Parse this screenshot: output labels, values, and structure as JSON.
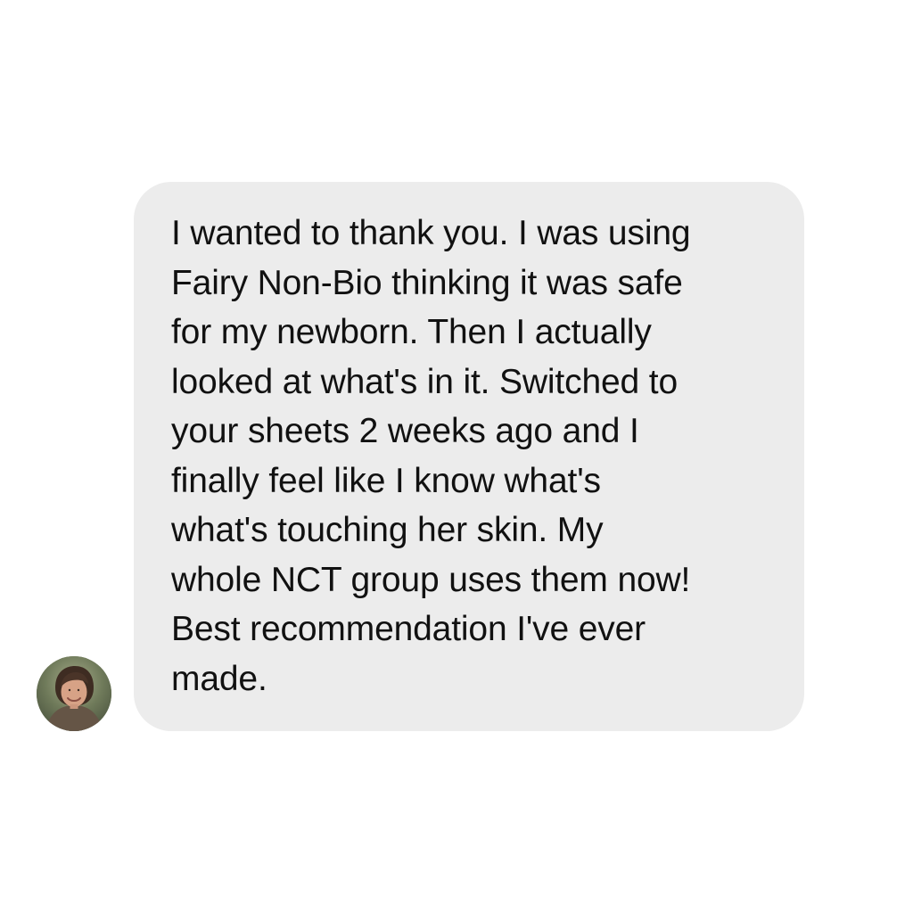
{
  "conversation": {
    "message": {
      "text": "I wanted to thank you. I was using\nFairy Non-Bio thinking it was safe\nfor my newborn. Then I actually\nlooked at what's in it. Switched to\nyour sheets 2 weeks ago and I\nfinally feel like I know what's\nwhat's touching her skin. My\nwhole NCT group uses them now!\nBest recommendation I've ever\nmade."
    }
  },
  "colors": {
    "page_background": "#ffffff",
    "bubble_background": "#ececec",
    "text": "#111111"
  },
  "icons": {
    "avatar": "avatar-photo"
  }
}
